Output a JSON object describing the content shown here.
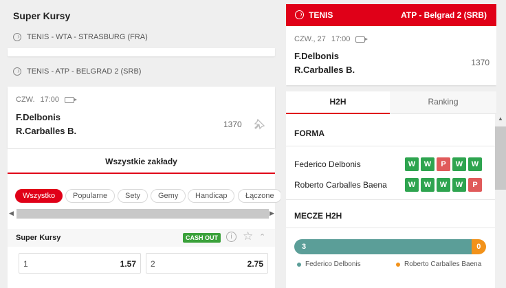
{
  "left": {
    "title": "Super Kursy",
    "leagues": [
      {
        "name": "TENIS - WTA - STRASBURG (FRA)"
      },
      {
        "name": "TENIS - ATP - BELGRAD 2 (SRB)"
      }
    ],
    "match": {
      "day": "CZW.",
      "time": "17:00",
      "player1": "F.Delbonis",
      "player2": "R.Carballes B.",
      "market_id": "1370"
    },
    "all_bets_label": "Wszystkie zakłady",
    "filters": [
      "Wszystko",
      "Popularne",
      "Sety",
      "Gemy",
      "Handicap",
      "Łączone"
    ],
    "active_filter": "Wszystko",
    "market": {
      "title": "Super Kursy",
      "cashout": "CASH OUT",
      "info_icon": "i"
    },
    "odds": [
      {
        "label": "1",
        "value": "1.57"
      },
      {
        "label": "2",
        "value": "2.75"
      }
    ]
  },
  "right": {
    "sport": "TENIS",
    "league": "ATP - Belgrad 2 (SRB)",
    "match": {
      "day": "CZW., 27",
      "time": "17:00",
      "player1": "F.Delbonis",
      "player2": "R.Carballes B.",
      "market_id": "1370"
    },
    "tabs": [
      "H2H",
      "Ranking"
    ],
    "form": {
      "title": "FORMA",
      "players": [
        {
          "name": "Federico Delbonis",
          "results": [
            "W",
            "W",
            "P",
            "W",
            "W"
          ]
        },
        {
          "name": "Roberto Carballes Baena",
          "results": [
            "W",
            "W",
            "W",
            "W",
            "P"
          ]
        }
      ]
    },
    "h2h": {
      "title": "MECZE H2H",
      "wins_a": "3",
      "wins_b": "0",
      "share_a": 0.92,
      "player_a": "Federico Delbonis",
      "player_b": "Roberto Carballes Baena",
      "color_a": "#5b9e98",
      "color_b": "#f2921a"
    }
  },
  "colors": {
    "accent": "#e00018",
    "win": "#2ea44f",
    "loss": "#e05a5a"
  }
}
